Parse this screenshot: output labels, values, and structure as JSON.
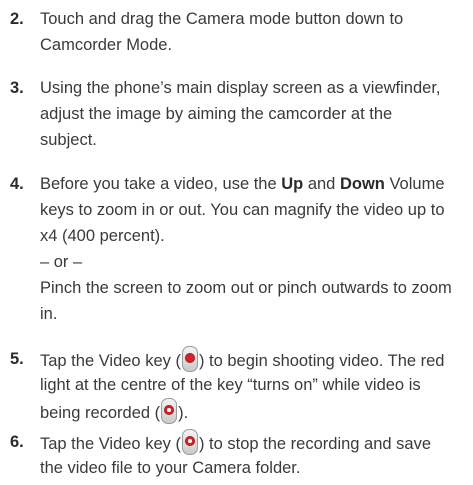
{
  "steps": [
    {
      "number": "2.",
      "lines": [
        "Touch and drag the Camera mode button down to",
        "Camcorder Mode."
      ]
    },
    {
      "number": "3.",
      "lines": [
        "Using the phone’s main display screen as a viewfinder,",
        "adjust the image by aiming the camcorder at the",
        "subject."
      ]
    },
    {
      "number": "4.",
      "line1": {
        "before": "Before you take a video, use the ",
        "up": "Up",
        "and": " and ",
        "down": "Down",
        "after": " Volume"
      },
      "lines": [
        "keys to zoom in or out. You can magnify the video up to",
        "x4 (400 percent)."
      ],
      "or": "– or –",
      "alt_lines": [
        "Pinch the screen to zoom out or pinch outwards to zoom",
        "in."
      ]
    },
    {
      "number": "5.",
      "line1": {
        "before": "Tap the Video key (",
        "after": ") to begin shooting video. The red"
      },
      "line2": "light at the centre of the key “turns on” while video is",
      "line3": {
        "before": "being recorded (",
        "after": ")."
      }
    },
    {
      "number": "6.",
      "line1": {
        "before": "Tap the Video key (",
        "after": ") to stop the recording and save"
      },
      "line2": "the video file to your Camera folder."
    }
  ],
  "icons": {
    "video_key_idle": "video-key-icon",
    "video_key_recording": "video-key-recording-icon"
  },
  "colors": {
    "text": "#3a3a3a",
    "record_red": "#d8222a"
  }
}
